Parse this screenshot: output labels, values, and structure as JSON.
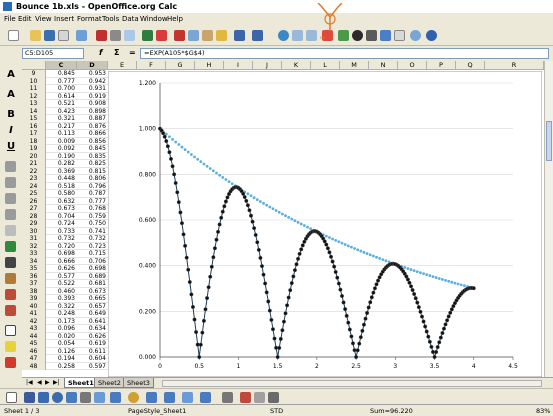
{
  "window": {
    "title": "Bounce 1b.xls - OpenOffice.org Calc"
  },
  "menu": [
    "File",
    "Edit",
    "View",
    "Insert",
    "Format",
    "Tools",
    "Data",
    "Window",
    "Help"
  ],
  "formula_bar": {
    "name_box": "C5:D105",
    "formula": "=EXP(A105*$G$4)",
    "fx_label": "f",
    "sum_label": "Σ",
    "equals_label": "="
  },
  "left_toolbar": [
    "A",
    "A",
    "B",
    "I",
    "U"
  ],
  "columns": [
    "C",
    "D",
    "E",
    "F",
    "G",
    "H",
    "I",
    "J",
    "K",
    "L",
    "M",
    "N",
    "O",
    "P",
    "Q",
    "R"
  ],
  "rows": [
    {
      "n": "9",
      "c": "0.845",
      "d": "0.953"
    },
    {
      "n": "10",
      "c": "0.777",
      "d": "0.942"
    },
    {
      "n": "11",
      "c": "0.700",
      "d": "0.931"
    },
    {
      "n": "12",
      "c": "0.614",
      "d": "0.919"
    },
    {
      "n": "13",
      "c": "0.521",
      "d": "0.908"
    },
    {
      "n": "14",
      "c": "0.423",
      "d": "0.898"
    },
    {
      "n": "15",
      "c": "0.321",
      "d": "0.887"
    },
    {
      "n": "16",
      "c": "0.217",
      "d": "0.876"
    },
    {
      "n": "17",
      "c": "0.113",
      "d": "0.866"
    },
    {
      "n": "18",
      "c": "0.009",
      "d": "0.856"
    },
    {
      "n": "19",
      "c": "0.092",
      "d": "0.845"
    },
    {
      "n": "20",
      "c": "0.190",
      "d": "0.835"
    },
    {
      "n": "21",
      "c": "0.282",
      "d": "0.825"
    },
    {
      "n": "22",
      "c": "0.369",
      "d": "0.815"
    },
    {
      "n": "23",
      "c": "0.448",
      "d": "0.806"
    },
    {
      "n": "24",
      "c": "0.518",
      "d": "0.796"
    },
    {
      "n": "25",
      "c": "0.580",
      "d": "0.787"
    },
    {
      "n": "26",
      "c": "0.632",
      "d": "0.777"
    },
    {
      "n": "27",
      "c": "0.673",
      "d": "0.768"
    },
    {
      "n": "28",
      "c": "0.704",
      "d": "0.759"
    },
    {
      "n": "29",
      "c": "0.724",
      "d": "0.750"
    },
    {
      "n": "30",
      "c": "0.733",
      "d": "0.741"
    },
    {
      "n": "31",
      "c": "0.732",
      "d": "0.732"
    },
    {
      "n": "32",
      "c": "0.720",
      "d": "0.723"
    },
    {
      "n": "33",
      "c": "0.698",
      "d": "0.715"
    },
    {
      "n": "34",
      "c": "0.666",
      "d": "0.706"
    },
    {
      "n": "35",
      "c": "0.626",
      "d": "0.698"
    },
    {
      "n": "36",
      "c": "0.577",
      "d": "0.689"
    },
    {
      "n": "37",
      "c": "0.522",
      "d": "0.681"
    },
    {
      "n": "38",
      "c": "0.460",
      "d": "0.673"
    },
    {
      "n": "39",
      "c": "0.393",
      "d": "0.665"
    },
    {
      "n": "40",
      "c": "0.322",
      "d": "0.657"
    },
    {
      "n": "41",
      "c": "0.248",
      "d": "0.649"
    },
    {
      "n": "42",
      "c": "0.173",
      "d": "0.641"
    },
    {
      "n": "43",
      "c": "0.096",
      "d": "0.634"
    },
    {
      "n": "44",
      "c": "0.020",
      "d": "0.626"
    },
    {
      "n": "45",
      "c": "0.054",
      "d": "0.619"
    },
    {
      "n": "46",
      "c": "0.126",
      "d": "0.611"
    },
    {
      "n": "47",
      "c": "0.194",
      "d": "0.604"
    },
    {
      "n": "48",
      "c": "0.258",
      "d": "0.597"
    }
  ],
  "sheet_tabs": [
    "Sheet1",
    "Sheet2",
    "Sheet3"
  ],
  "status": {
    "sheet": "Sheet 1 / 3",
    "page_style": "PageStyle_Sheet1",
    "mode": "STD",
    "sum": "Sum=96.220",
    "zoom": "83%"
  },
  "colors": {
    "bounce": "#1a3e5c",
    "decay": "#5aaee0"
  },
  "chart_data": {
    "type": "scatter",
    "xlim": [
      0,
      4.5
    ],
    "ylim": [
      0,
      1.2
    ],
    "xticks": [
      "0",
      "0.5",
      "1",
      "1.5",
      "2",
      "2.5",
      "3",
      "3.5",
      "4",
      "4.5"
    ],
    "yticks": [
      "0.000",
      "0.200",
      "0.400",
      "0.600",
      "0.800",
      "1.000",
      "1.200"
    ],
    "decay_rate": -0.3,
    "bounce_frequency": 3.14159,
    "x_end": 4.0,
    "series": [
      {
        "type": "line+markers",
        "formula": "abs(exp(-0.3x)*cos(pi*x))"
      },
      {
        "type": "markers",
        "formula": "exp(-0.3x)"
      }
    ]
  }
}
